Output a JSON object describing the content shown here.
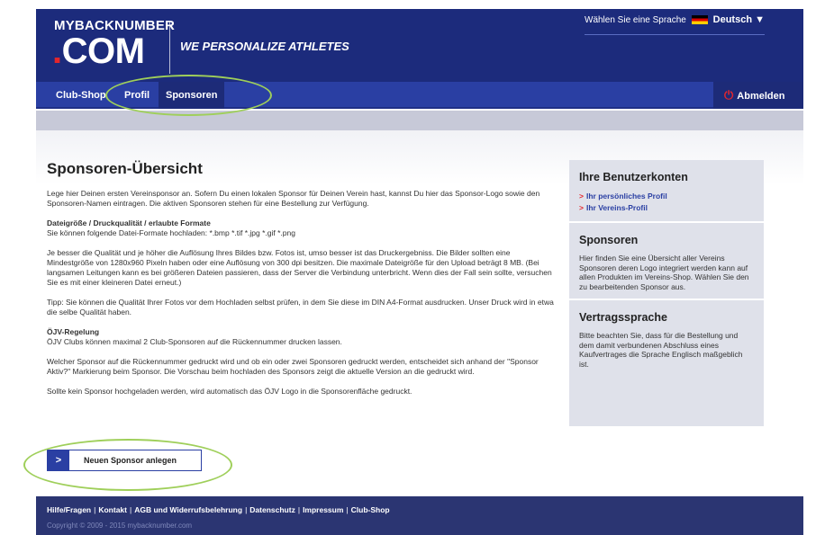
{
  "header": {
    "logo_top": "MYBACKNUMBER",
    "logo_bottom": ".COM",
    "tagline": "WE PERSONALIZE ATHLETES",
    "language_label": "Wählen Sie eine Sprache",
    "language_value": "Deutsch ▼"
  },
  "nav": {
    "items": [
      {
        "label": "Club-Shop"
      },
      {
        "label": "Profil"
      },
      {
        "label": "Sponsoren"
      }
    ],
    "logout_label": "Abmelden"
  },
  "main": {
    "title": "Sponsoren-Übersicht",
    "intro": "Lege hier Deinen ersten Vereinsponsor an. Sofern Du einen lokalen Sponsor für Deinen Verein hast, kannst Du hier das Sponsor-Logo sowie den Sponsoren-Namen eintragen. Die aktiven Sponsoren stehen für eine Bestellung zur Verfügung.",
    "formats_heading": "Dateigröße / Druckqualität / erlaubte Formate",
    "formats_text": "Sie können folgende Datei-Formate hochladen: *.bmp *.tif *.jpg *.gif *.png",
    "quality_text": "Je besser die Qualität und je höher die Auflösung Ihres Bildes bzw. Fotos ist, umso besser ist das Druckergebniss. Die Bilder sollten eine Mindestgröße von 1280x960 Pixeln haben oder eine Auflösung von 300 dpi besitzen. Die maximale Dateigröße für den Upload beträgt 8 MB. (Bei langsamen Leitungen kann es bei größeren Dateien passieren, dass der Server die Verbindung unterbricht. Wenn dies der Fall sein sollte, versuchen Sie es mit einer kleineren Datei erneut.)",
    "tip_text": "Tipp: Sie können die Qualität Ihrer Fotos vor dem Hochladen selbst prüfen, in dem Sie diese im DIN A4-Format ausdrucken. Unser Druck wird in etwa die selbe Qualität haben.",
    "ojv_heading": "ÖJV-Regelung",
    "ojv_text": "ÖJV Clubs können maximal 2 Club-Sponsoren auf die Rückennummer drucken lassen.",
    "which_text": "Welcher Sponsor auf die Rückennummer gedruckt wird und ob ein oder zwei Sponsoren gedruckt werden, entscheidet sich anhand der \"Sponsor Aktiv?\" Markierung beim Sponsor. Die Vorschau beim hochladen des Sponsors zeigt die aktuelle Version an die gedruckt wird.",
    "none_text": "Sollte kein Sponsor hochgeladen werden, wird automatisch das ÖJV Logo in die Sponsorenfläche gedruckt.",
    "cta_arrow": ">",
    "cta_label": "Neuen Sponsor anlegen"
  },
  "sidebar": {
    "accounts_title": "Ihre Benutzerkonten",
    "link_chevron": ">",
    "links": [
      {
        "label": "Ihr persönliches Profil"
      },
      {
        "label": "Ihr Vereins-Profil"
      }
    ],
    "sponsors_title": "Sponsoren",
    "sponsors_text": "Hier finden Sie eine Übersicht aller Vereins Sponsoren deren Logo integriert werden kann auf allen Produkten im Vereins-Shop. Wählen Sie den zu bearbeitenden Sponsor aus.",
    "contract_title": "Vertragssprache",
    "contract_text": "Bitte beachten Sie, dass für die Bestellung und dem damit verbundenen Abschluss eines Kaufvertrages die Sprache Englisch maßgeblich ist."
  },
  "footer": {
    "links": [
      {
        "label": "Hilfe/Fragen"
      },
      {
        "label": "Kontakt"
      },
      {
        "label": "AGB und Widerrufsbelehrung"
      },
      {
        "label": "Datenschutz"
      },
      {
        "label": "Impressum"
      },
      {
        "label": "Club-Shop"
      }
    ],
    "separator": "|",
    "copyright": "Copyright © 2009 - 2015 mybacknumber.com"
  },
  "colors": {
    "header_bg": "#1c2b7c",
    "nav_bg": "#2a3fa3",
    "accent_red": "#e3262c",
    "annotation_green": "#9fcf5a"
  }
}
